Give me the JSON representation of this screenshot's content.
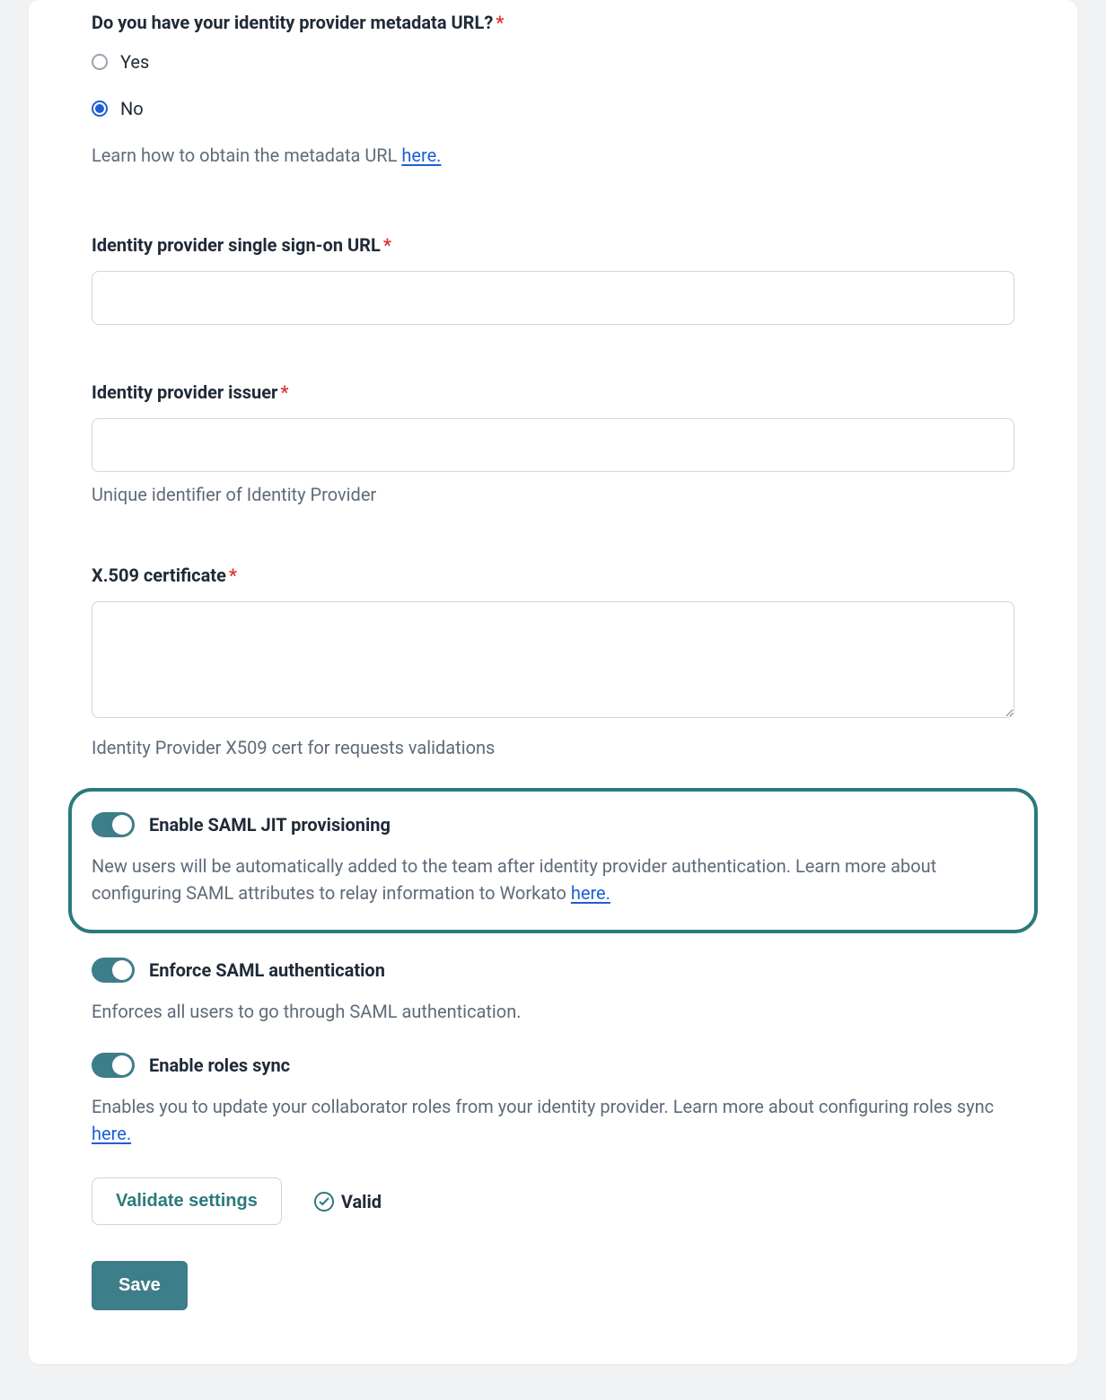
{
  "metadata_question": {
    "label": "Do you have your identity provider metadata URL?",
    "options": {
      "yes": "Yes",
      "no": "No"
    },
    "selected": "no",
    "helper_prefix": "Learn how to obtain the metadata URL ",
    "helper_link": "here."
  },
  "sso_url": {
    "label": "Identity provider single sign-on URL",
    "value": ""
  },
  "issuer": {
    "label": "Identity provider issuer",
    "value": "",
    "helper": "Unique identifier of Identity Provider"
  },
  "x509": {
    "label": "X.509 certificate",
    "value": "",
    "helper": "Identity Provider X509 cert for requests validations"
  },
  "jit": {
    "label": "Enable SAML JIT provisioning",
    "desc_prefix": "New users will be automatically added to the team after identity provider authentication. Learn more about configuring SAML attributes to relay information to Workato ",
    "desc_link": "here."
  },
  "enforce": {
    "label": "Enforce SAML authentication",
    "desc": "Enforces all users to go through SAML authentication."
  },
  "roles_sync": {
    "label": "Enable roles sync",
    "desc_prefix": "Enables you to update your collaborator roles from your identity provider. Learn more about configuring roles sync ",
    "desc_link": "here."
  },
  "actions": {
    "validate": "Validate settings",
    "valid": "Valid",
    "save": "Save"
  }
}
